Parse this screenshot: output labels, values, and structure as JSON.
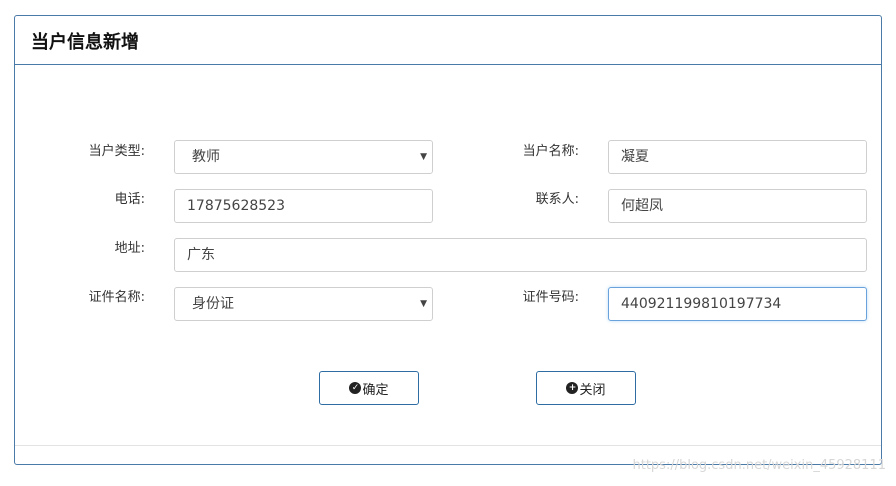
{
  "modal": {
    "title": "当户信息新增"
  },
  "form": {
    "user_type": {
      "label": "当户类型:",
      "value": "教师"
    },
    "user_name": {
      "label": "当户名称:",
      "value": "凝夏"
    },
    "phone": {
      "label": "电话:",
      "value": "17875628523"
    },
    "contact": {
      "label": "联系人:",
      "value": "何超凤"
    },
    "address": {
      "label": "地址:",
      "value": "广东"
    },
    "id_type": {
      "label": "证件名称:",
      "value": "身份证"
    },
    "id_number": {
      "label": "证件号码:",
      "value": "440921199810197734"
    }
  },
  "buttons": {
    "confirm_label": "确定",
    "close_label": "关闭"
  },
  "icons": {
    "confirm": "check-circle-icon",
    "close": "plus-circle-icon",
    "select_caret": "caret-down-icon"
  },
  "watermark": "https://blog.csdn.net/weixin_45928111",
  "colors": {
    "border": "#4a7aa8",
    "button_border": "#2e6da4",
    "focus": "#6aa3dc"
  }
}
